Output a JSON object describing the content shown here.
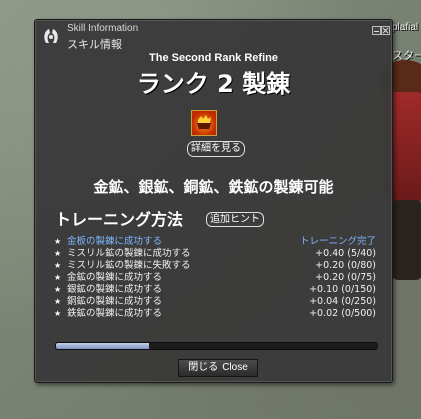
{
  "window": {
    "title_en": "Skill Information",
    "title_jp": "スキル情報"
  },
  "skill": {
    "subtitle": "The Second Rank Refine",
    "rank_title": "ランク 2 製錬",
    "details_button": "詳細を見る",
    "refine_line": "金鉱、銀鉱、銅鉱、鉄鉱の製錬可能"
  },
  "training": {
    "header": "トレーニング方法",
    "hint_button": "追加ヒント",
    "rows": [
      {
        "label": "金板の製錬に成功する",
        "value": "トレーニング完了",
        "done": true
      },
      {
        "label": "ミスリル鉱の製錬に成功する",
        "value": "+0.40 (5/40)",
        "done": false
      },
      {
        "label": "ミスリル鉱の製錬に失敗する",
        "value": "+0.20 (0/80)",
        "done": false
      },
      {
        "label": "金鉱の製錬に成功する",
        "value": "+0.20 (0/75)",
        "done": false
      },
      {
        "label": "銀鉱の製錬に成功する",
        "value": "+0.10 (0/150)",
        "done": false
      },
      {
        "label": "銅鉱の製錬に成功する",
        "value": "+0.04 (0/250)",
        "done": false
      },
      {
        "label": "鉄鉱の製錬に成功する",
        "value": "+0.02 (0/500)",
        "done": false
      }
    ],
    "progress_fraction": 0.29
  },
  "close_button": {
    "jp": "閉じる",
    "en": "Close"
  },
  "background": {
    "name_fragment": "plafial",
    "text_fragment": "スター"
  },
  "icons": {
    "title": "skill-info-icon",
    "skill": "refine-fire-icon"
  },
  "colors": {
    "window_bg": "#3a3a3a",
    "completed_text": "#7fb6ff",
    "progress_fill": "#9fb0d8"
  }
}
